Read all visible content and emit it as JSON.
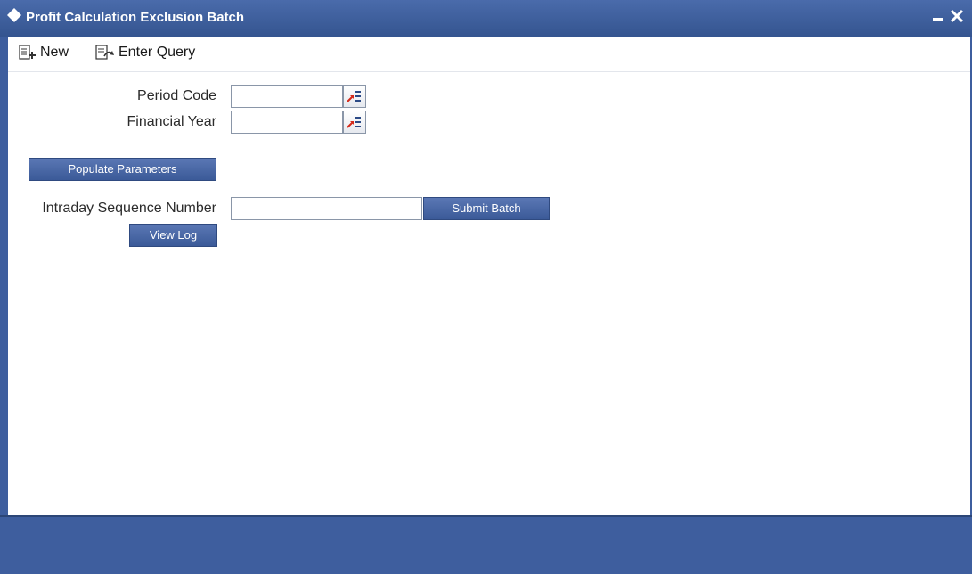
{
  "window": {
    "title": "Profit Calculation Exclusion Batch",
    "icons": {
      "title": "diamond-icon",
      "minimize": "minimize-icon",
      "close": "close-icon"
    }
  },
  "toolbar": {
    "new_label": "New",
    "new_icon": "new-document-icon",
    "query_label": "Enter Query",
    "query_icon": "enter-query-icon"
  },
  "form": {
    "period_code": {
      "label": "Period Code",
      "value": "",
      "lov_icon": "list-of-values-icon"
    },
    "financial_year": {
      "label": "Financial Year",
      "value": "",
      "lov_icon": "list-of-values-icon"
    },
    "populate_parameters_label": "Populate Parameters",
    "intraday_sequence": {
      "label": "Intraday Sequence Number",
      "value": ""
    },
    "submit_batch_label": "Submit Batch",
    "view_log_label": "View Log"
  },
  "colors": {
    "frame": "#3e5e9e",
    "button": "#4a69a8",
    "lov_accent": "#d42a1a"
  }
}
